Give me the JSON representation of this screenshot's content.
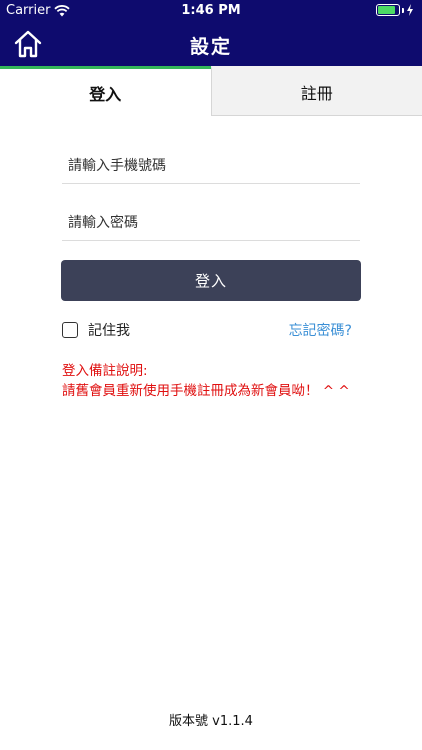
{
  "status_bar": {
    "carrier": "Carrier",
    "time": "1:46 PM",
    "battery_level": 0.85,
    "wifi_icon": "wifi-icon",
    "battery_icon": "battery-icon"
  },
  "nav": {
    "title": "設定",
    "home_icon": "home-icon"
  },
  "tabs": [
    {
      "label": "登入",
      "active": true
    },
    {
      "label": "註冊",
      "active": false
    }
  ],
  "form": {
    "phone_placeholder": "請輸入手機號碼",
    "password_placeholder": "請輸入密碼",
    "login_label": "登入",
    "remember_label": "記住我",
    "forgot_label": "忘記密碼?"
  },
  "note": {
    "heading": "登入備註說明:",
    "body": "請舊會員重新使用手機註冊成為新會員呦！ ^ ^"
  },
  "footer": {
    "version": "版本號 v1.1.4"
  },
  "colors": {
    "nav_bg": "#0e0b6e",
    "tab_accent": "#35b85a",
    "button_bg": "#3c4158",
    "note_text": "#e01010",
    "link": "#3a8fd6"
  }
}
